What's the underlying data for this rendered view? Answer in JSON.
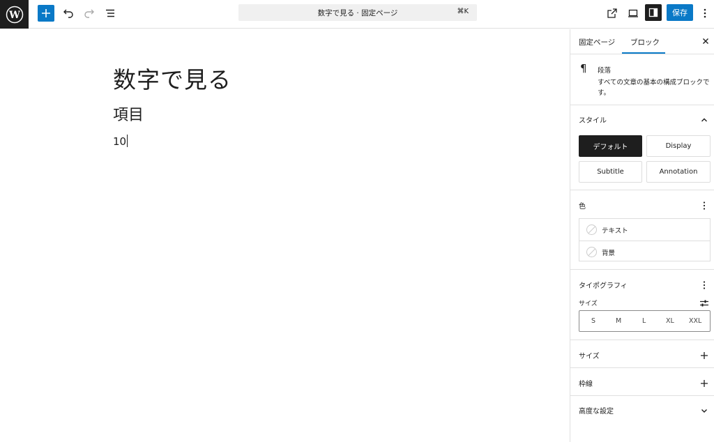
{
  "header": {
    "logo_icon": "wordpress-logo-icon",
    "toolbar_icons": [
      "plus-icon",
      "undo-icon",
      "redo-icon",
      "list-view-icon"
    ],
    "command_palette": {
      "label": "数字で見る · 固定ページ",
      "shortcut": "⌘K"
    },
    "right_icons": [
      "external-link-icon",
      "desktop-preview-icon",
      "settings-sidebar-icon",
      "kebab-menu-icon"
    ],
    "save_label": "保存"
  },
  "canvas": {
    "title": "数字で見る",
    "heading": "項目",
    "paragraph": "10"
  },
  "sidebar": {
    "tabs": [
      "固定ページ",
      "ブロック"
    ],
    "active_tab": "ブロック",
    "block_card": {
      "icon": "¶",
      "name": "段落",
      "description": "すべての文章の基本の構成ブロックです。"
    },
    "styles": {
      "title": "スタイル",
      "options": [
        "デフォルト",
        "Display",
        "Subtitle",
        "Annotation"
      ],
      "active": "デフォルト"
    },
    "color": {
      "title": "色",
      "items": [
        "テキスト",
        "背景"
      ]
    },
    "typography": {
      "title": "タイポグラフィ",
      "size_label": "サイズ",
      "sizes": [
        "S",
        "M",
        "L",
        "XL",
        "XXL"
      ]
    },
    "dimensions": {
      "title": "サイズ"
    },
    "border": {
      "title": "枠線"
    },
    "advanced": {
      "title": "高度な設定"
    }
  },
  "colors": {
    "accent": "#0a79c7",
    "dark": "#1e1e1e",
    "border": "#e0e0e0"
  }
}
